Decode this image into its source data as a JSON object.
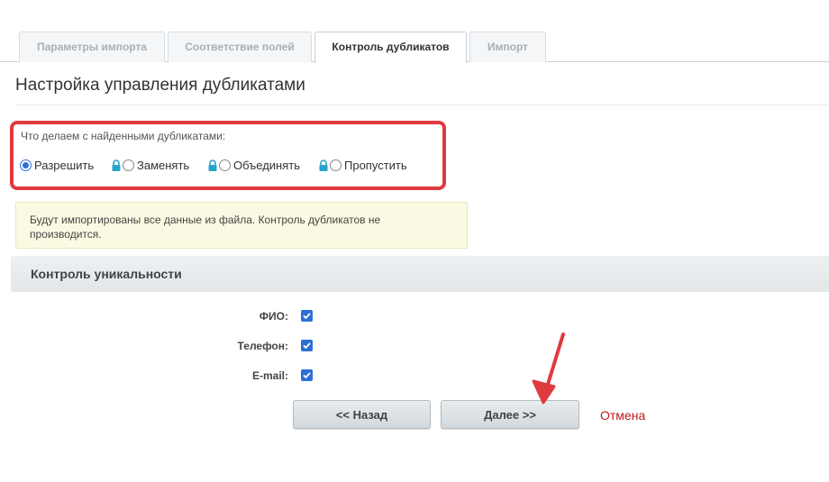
{
  "tabs": [
    {
      "label": "Параметры импорта",
      "active": false
    },
    {
      "label": "Соответствие полей",
      "active": false
    },
    {
      "label": "Контроль дубликатов",
      "active": true
    },
    {
      "label": "Импорт",
      "active": false
    }
  ],
  "page_title": "Настройка управления дубликатами",
  "duplicates": {
    "question": "Что делаем с найденными дубликатами:",
    "options": [
      {
        "label": "Разрешить",
        "selected": true,
        "locked": false
      },
      {
        "label": "Заменять",
        "selected": false,
        "locked": true
      },
      {
        "label": "Объединять",
        "selected": false,
        "locked": true
      },
      {
        "label": "Пропустить",
        "selected": false,
        "locked": true
      }
    ]
  },
  "note": "Будут импортированы все данные из файла. Контроль дубликатов не производится.",
  "uniqueness": {
    "header": "Контроль уникальности",
    "fields": [
      {
        "label": "ФИО:",
        "checked": true
      },
      {
        "label": "Телефон:",
        "checked": true
      },
      {
        "label": "E-mail:",
        "checked": true
      }
    ]
  },
  "buttons": {
    "back": "<< Назад",
    "next": "Далее >>",
    "cancel": "Отмена"
  },
  "colors": {
    "highlight": "#e03a3e",
    "accent": "#2e6fd6",
    "lock": "#2aa3c9",
    "cancel": "#c0181d"
  },
  "icons": {
    "lock": "lock-icon",
    "annotation": "red-arrow-annotation"
  }
}
